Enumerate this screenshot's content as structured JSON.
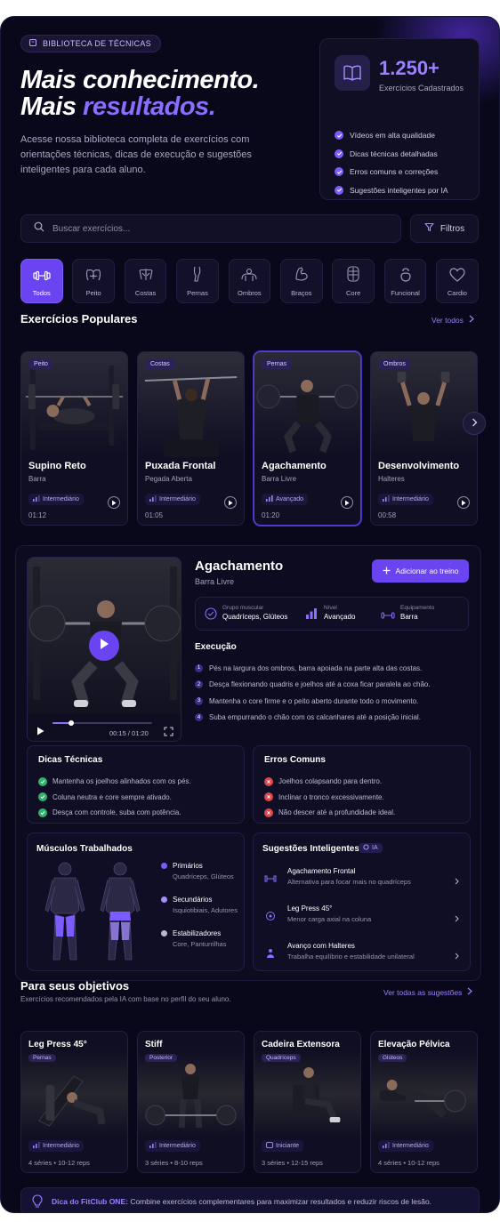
{
  "badge": "BIBLIOTECA DE TÉCNICAS",
  "hero": {
    "line1": "Mais conhecimento.",
    "line2_prefix": "Mais ",
    "line2_accent": "resultados.",
    "lead": "Acesse nossa biblioteca completa de exercícios com orientações técnicas, dicas de execução e sugestões inteligentes para cada aluno."
  },
  "stats": {
    "number": "1.250+",
    "label": "Exercícios Cadastrados",
    "features": [
      "Vídeos em alta qualidade",
      "Dicas técnicas detalhadas",
      "Erros comuns e correções",
      "Sugestões inteligentes por IA"
    ]
  },
  "search": {
    "placeholder": "Buscar exercícios...",
    "filters_label": "Filtros"
  },
  "categories": [
    "Todos",
    "Peito",
    "Costas",
    "Pernas",
    "Ombros",
    "Braços",
    "Core",
    "Funcional",
    "Cardio"
  ],
  "popular": {
    "title": "Exercícios Populares",
    "see_all": "Ver todos",
    "cards": [
      {
        "tag": "Peito",
        "name": "Supino Reto",
        "equipment": "Barra",
        "level": "Intermediário",
        "duration": "01:12"
      },
      {
        "tag": "Costas",
        "name": "Puxada Frontal",
        "equipment": "Pegada Aberta",
        "level": "Intermediário",
        "duration": "01:05"
      },
      {
        "tag": "Pernas",
        "name": "Agachamento",
        "equipment": "Barra Livre",
        "level": "Avançado",
        "duration": "01:20"
      },
      {
        "tag": "Ombros",
        "name": "Desenvolvimento",
        "equipment": "Halteres",
        "level": "Intermediário",
        "duration": "00:58"
      }
    ]
  },
  "detail": {
    "name": "Agachamento",
    "equipment_sub": "Barra Livre",
    "add_button": "Adicionar ao treino",
    "video": {
      "time": "00:15 / 01:20",
      "progress": 0.19
    },
    "meta": [
      {
        "label": "Grupo muscular",
        "value": "Quadríceps, Glúteos"
      },
      {
        "label": "Nível",
        "value": "Avançado"
      },
      {
        "label": "Equipamento",
        "value": "Barra"
      }
    ],
    "execution_title": "Execução",
    "steps": [
      "Pés na largura dos ombros, barra apoiada na parte alta das costas.",
      "Desça flexionando quadris e joelhos até a coxa ficar paralela ao chão.",
      "Mantenha o core firme e o peito aberto durante todo o movimento.",
      "Suba empurrando o chão com os calcanhares até a posição inicial."
    ],
    "tips_title": "Dicas Técnicas",
    "tips": [
      "Mantenha os joelhos alinhados com os pés.",
      "Coluna neutra e core sempre ativado.",
      "Desça com controle, suba com potência."
    ],
    "errors_title": "Erros Comuns",
    "errors": [
      "Joelhos colapsando para dentro.",
      "Inclinar o tronco excessivamente.",
      "Não descer até a profundidade ideal."
    ],
    "muscles_title": "Músculos Trabalhados",
    "muscles": [
      {
        "label": "Primários",
        "value": "Quadríceps, Glúteos",
        "color": "#7d5cff"
      },
      {
        "label": "Secundários",
        "value": "Isquiotibiais, Adutores",
        "color": "#a58dff"
      },
      {
        "label": "Estabilizadores",
        "value": "Core, Panturrilhas",
        "color": "#b9b7cc"
      }
    ],
    "suggest_title": "Sugestões Inteligentes",
    "suggest_badge": "IA",
    "suggestions": [
      {
        "title": "Agachamento Frontal",
        "desc": "Alternativa para focar mais no quadríceps"
      },
      {
        "title": "Leg Press 45°",
        "desc": "Menor carga axial na coluna"
      },
      {
        "title": "Avanço com Halteres",
        "desc": "Trabalha equilíbrio e estabilidade unilateral"
      }
    ]
  },
  "goals": {
    "title": "Para seus objetivos",
    "subtitle": "Exercícios recomendados pela IA com base no perfil do seu aluno.",
    "see_all": "Ver todas as sugestões",
    "cards": [
      {
        "name": "Leg Press 45°",
        "tag": "Pernas",
        "level": "Intermediário",
        "reps": "4 séries • 10-12 reps"
      },
      {
        "name": "Stiff",
        "tag": "Posterior",
        "level": "Intermediário",
        "reps": "3 séries • 8-10 reps"
      },
      {
        "name": "Cadeira Extensora",
        "tag": "Quadríceps",
        "level": "Iniciante",
        "reps": "3 séries • 12-15 reps"
      },
      {
        "name": "Elevação Pélvica",
        "tag": "Glúteos",
        "level": "Intermediário",
        "reps": "4 séries • 10-12 reps"
      }
    ]
  },
  "tip": {
    "label": "Dica do FitClub ONE:",
    "text": " Combine exercícios complementares para maximizar resultados e reduzir riscos de lesão."
  },
  "colors": {
    "accent": "#7d5cff",
    "background": "#08081a",
    "success": "#2fb36b",
    "error": "#e0454b"
  }
}
